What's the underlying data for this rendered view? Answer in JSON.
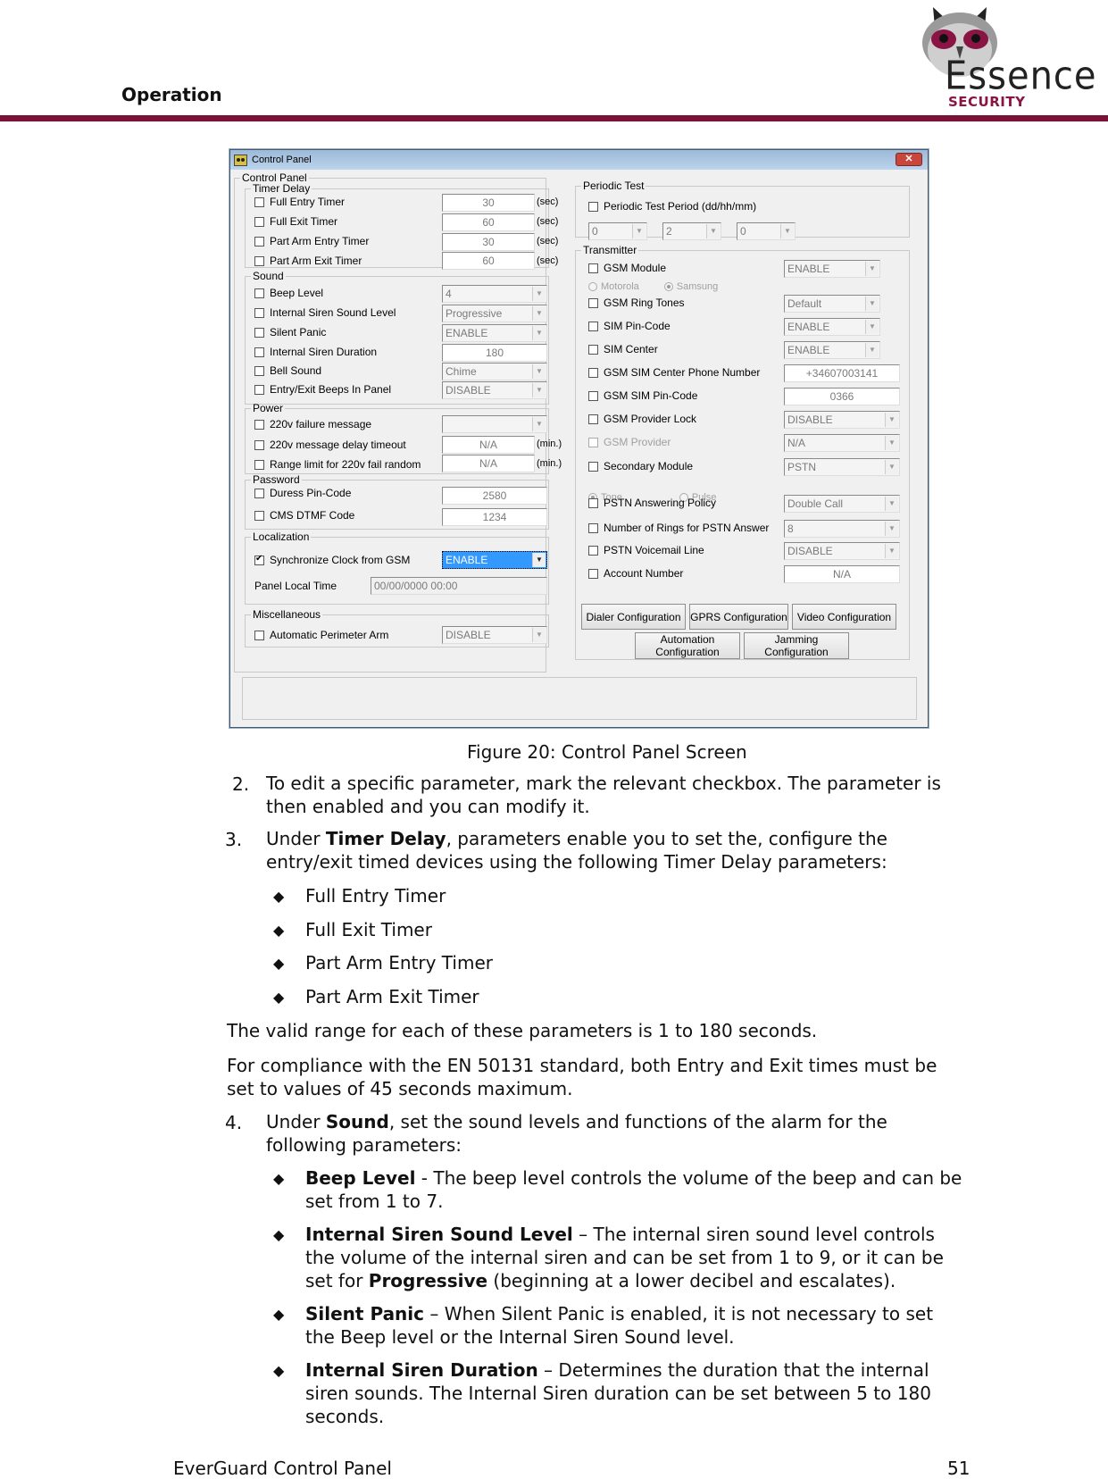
{
  "header": {
    "section_title": "Operation",
    "logo": {
      "word": "Essence",
      "sub": "SECURITY",
      "icon": "owl-icon"
    },
    "colors": {
      "rule": "#7a1238",
      "logo_accent": "#8a1545"
    }
  },
  "window": {
    "title": "Control Panel",
    "close_label": "✕",
    "main_group": "Control Panel",
    "timer_delay": {
      "legend": "Timer Delay",
      "rows": [
        {
          "label": "Full Entry Timer",
          "value": "30",
          "unit": "(sec)",
          "checked": false
        },
        {
          "label": "Full Exit Timer",
          "value": "60",
          "unit": "(sec)",
          "checked": false
        },
        {
          "label": "Part Arm Entry Timer",
          "value": "30",
          "unit": "(sec)",
          "checked": false
        },
        {
          "label": "Part Arm Exit Timer",
          "value": "60",
          "unit": "(sec)",
          "checked": false
        }
      ]
    },
    "sound": {
      "legend": "Sound",
      "rows": [
        {
          "label": "Beep Level",
          "value": "4",
          "type": "combo"
        },
        {
          "label": "Internal Siren Sound Level",
          "value": "Progressive",
          "type": "combo"
        },
        {
          "label": "Silent Panic",
          "value": "ENABLE",
          "type": "combo"
        },
        {
          "label": "Internal Siren Duration",
          "value": "180",
          "type": "text"
        },
        {
          "label": "Bell Sound",
          "value": "Chime",
          "type": "combo"
        },
        {
          "label": "Entry/Exit Beeps In Panel",
          "value": "DISABLE",
          "type": "combo"
        }
      ]
    },
    "power": {
      "legend": "Power",
      "rows": [
        {
          "label": "220v failure message",
          "value": "",
          "type": "combo"
        },
        {
          "label": "220v message delay timeout",
          "value": "N/A",
          "unit": "(min.)",
          "type": "text"
        },
        {
          "label": "Range limit for 220v fail random",
          "value": "N/A",
          "unit": "(min.)",
          "type": "text"
        }
      ]
    },
    "password": {
      "legend": "Password",
      "rows": [
        {
          "label": "Duress Pin-Code",
          "value": "2580"
        },
        {
          "label": "CMS DTMF Code",
          "value": "1234"
        }
      ]
    },
    "localization": {
      "legend": "Localization",
      "sync_label": "Synchronize Clock from GSM",
      "sync_checked": true,
      "sync_value": "ENABLE",
      "time_label": "Panel Local Time",
      "time_value": "00/00/0000 00:00"
    },
    "miscellaneous": {
      "legend": "Miscellaneous",
      "label": "Automatic Perimeter Arm",
      "value": "DISABLE"
    },
    "periodic_test": {
      "legend": "Periodic Test",
      "label": "Periodic Test Period (dd/hh/mm)",
      "values": [
        "0",
        "2",
        "0"
      ]
    },
    "transmitter": {
      "legend": "Transmitter",
      "rows": [
        {
          "label": "GSM Module",
          "value": "ENABLE",
          "type": "combo"
        },
        {
          "label": "GSM Ring Tones",
          "value": "Default",
          "type": "combo"
        },
        {
          "label": "SIM Pin-Code",
          "value": "ENABLE",
          "type": "combo"
        },
        {
          "label": "SIM Center",
          "value": "ENABLE",
          "type": "combo"
        },
        {
          "label": "GSM SIM Center Phone Number",
          "value": "+34607003141",
          "type": "text"
        },
        {
          "label": "GSM SIM Pin-Code",
          "value": "0366",
          "type": "text"
        },
        {
          "label": "GSM Provider Lock",
          "value": "DISABLE",
          "type": "combo"
        },
        {
          "label": "GSM Provider",
          "value": "N/A",
          "type": "combo",
          "disabled": true
        },
        {
          "label": "Secondary Module",
          "value": "PSTN",
          "type": "combo"
        },
        {
          "label": "PSTN Answering Policy",
          "value": "Double Call",
          "type": "combo"
        },
        {
          "label": "Number of Rings for PSTN Answer",
          "value": "8",
          "type": "combo"
        },
        {
          "label": "PSTN Voicemail Line",
          "value": "DISABLE",
          "type": "combo"
        },
        {
          "label": "Account Number",
          "value": "N/A",
          "type": "text"
        }
      ],
      "gsm_radios": [
        {
          "label": "Motorola",
          "selected": false
        },
        {
          "label": "Samsung",
          "selected": true
        }
      ],
      "dial_radios": [
        {
          "label": "Tone",
          "selected": true
        },
        {
          "label": "Pulse",
          "selected": false
        }
      ],
      "buttons": {
        "dialer": "Dialer Configuration",
        "gprs": "GPRS Configuration",
        "video": "Video Configuration",
        "automation_1": "Automation",
        "automation_2": "Configuration",
        "jamming_1": "Jamming",
        "jamming_2": "Configuration"
      }
    }
  },
  "document": {
    "caption": "Figure 20: Control Panel Screen",
    "step2_num": "2.",
    "step2_l1": "To edit a specific parameter, mark the relevant checkbox. The parameter is",
    "step2_l2": "then enabled and you can modify it.",
    "step3_num": "3.",
    "step3_pre": "Under ",
    "step3_bold": "Timer Delay",
    "step3_post": ", parameters enable you to set the, configure the",
    "step3_l2": "entry/exit timed devices using the following Timer Delay parameters:",
    "timer_bullets": [
      "Full Entry Timer",
      "Full Exit Timer",
      "Part Arm Entry Timer",
      "Part Arm Exit Timer"
    ],
    "range_note": "The valid range for each of these parameters is 1 to 180 seconds.",
    "compliance_l1": "For compliance with the EN 50131 standard, both Entry and Exit times must be",
    "compliance_l2": "set to values of 45 seconds maximum.",
    "step4_num": "4.",
    "step4_pre": "Under ",
    "step4_bold": "Sound",
    "step4_post": ", set the sound levels and functions of the alarm for the",
    "step4_l2": "following parameters:",
    "sound_bullets": [
      {
        "bold": "Beep Level",
        "l1": " - The beep level controls the volume of the beep and can be",
        "l2": "set from 1 to 7."
      },
      {
        "bold": "Internal Siren Sound Level",
        "l1": " – The internal siren sound level controls",
        "l2": "the volume of the internal siren and can be set from 1 to 9, or it can be",
        "l3_pre": "set for ",
        "l3_bold": "Progressive",
        "l3_post": " (beginning at a lower decibel and escalates)."
      },
      {
        "bold": "Silent Panic",
        "l1": " – When Silent Panic is enabled, it is not necessary to set",
        "l2": "the Beep level or the Internal Siren Sound level."
      },
      {
        "bold": "Internal Siren Duration",
        "l1": " – Determines the duration that the internal",
        "l2": "siren sounds. The Internal Siren duration can be set between 5 to 180",
        "l3": "seconds."
      }
    ],
    "bullet_icon": "diamond-bullet-icon"
  },
  "footer": {
    "product": "EverGuard Control Panel",
    "page": "51"
  }
}
